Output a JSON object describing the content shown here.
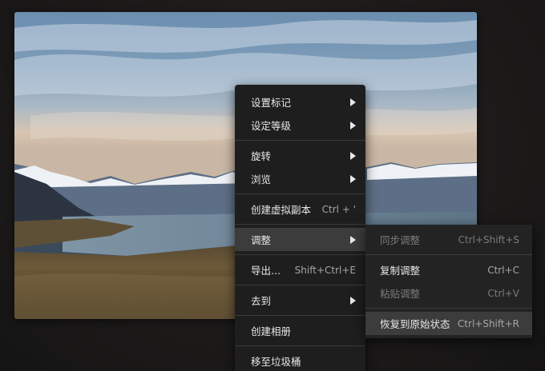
{
  "context_menu": {
    "items": [
      {
        "label": "设置标记",
        "shortcut": "",
        "submenu": true
      },
      {
        "label": "设定等级",
        "shortcut": "",
        "submenu": true
      },
      {
        "label": "旋转",
        "shortcut": "",
        "submenu": true
      },
      {
        "label": "浏览",
        "shortcut": "",
        "submenu": true
      },
      {
        "label": "创建虚拟副本",
        "shortcut": "Ctrl + '",
        "submenu": false
      },
      {
        "label": "调整",
        "shortcut": "",
        "submenu": true,
        "active": true
      },
      {
        "label": "导出...",
        "shortcut": "Shift+Ctrl+E",
        "submenu": false
      },
      {
        "label": "去到",
        "shortcut": "",
        "submenu": true
      },
      {
        "label": "创建相册",
        "shortcut": "",
        "submenu": false
      },
      {
        "label": "移至垃圾桶",
        "shortcut": "",
        "submenu": false
      }
    ]
  },
  "adjust_submenu": {
    "items": [
      {
        "label": "同步调整",
        "shortcut": "Ctrl+Shift+S",
        "enabled": false
      },
      {
        "label": "复制调整",
        "shortcut": "Ctrl+C",
        "enabled": true
      },
      {
        "label": "粘贴调整",
        "shortcut": "Ctrl+V",
        "enabled": false
      },
      {
        "label": "恢复到原始状态",
        "shortcut": "Ctrl+Shift+R",
        "enabled": true,
        "active": true
      }
    ]
  },
  "colors": {
    "menu_bg": "#1e1e1e",
    "submenu_bg": "#232323",
    "highlight": "#3c3c3c",
    "text": "#e8e8e8",
    "disabled_text": "#7c7c7c"
  }
}
